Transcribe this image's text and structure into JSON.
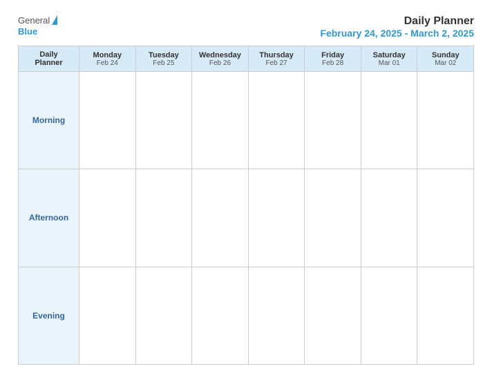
{
  "logo": {
    "general": "General",
    "blue": "Blue",
    "triangle_label": "logo-triangle"
  },
  "header": {
    "title": "Daily Planner",
    "subtitle": "February 24, 2025 - March 2, 2025"
  },
  "calendar": {
    "label_col": {
      "line1": "Daily",
      "line2": "Planner"
    },
    "days": [
      {
        "name": "Monday",
        "date": "Feb 24"
      },
      {
        "name": "Tuesday",
        "date": "Feb 25"
      },
      {
        "name": "Wednesday",
        "date": "Feb 26"
      },
      {
        "name": "Thursday",
        "date": "Feb 27"
      },
      {
        "name": "Friday",
        "date": "Feb 28"
      },
      {
        "name": "Saturday",
        "date": "Mar 01"
      },
      {
        "name": "Sunday",
        "date": "Mar 02"
      }
    ],
    "time_slots": [
      {
        "label": "Morning"
      },
      {
        "label": "Afternoon"
      },
      {
        "label": "Evening"
      }
    ]
  }
}
